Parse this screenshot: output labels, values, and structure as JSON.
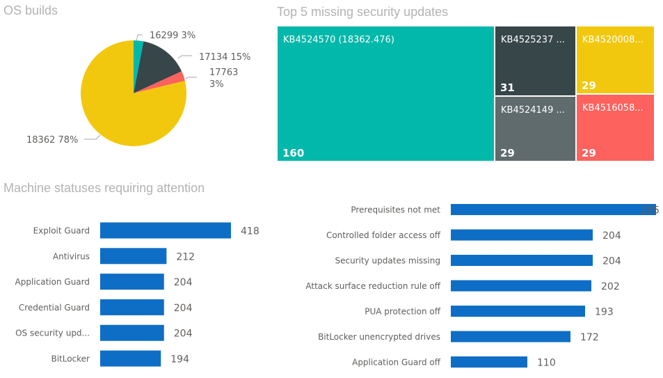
{
  "colors": {
    "teal": "#01b8aa",
    "dark": "#374649",
    "red": "#fd625e",
    "yellow": "#f2c80f",
    "gray": "#5f6b6d",
    "bar": "#0e6ec5",
    "label": "#605e5c",
    "title": "#b3b3b3",
    "leader": "#a6a6a6"
  },
  "chart_data": [
    {
      "id": "os-builds",
      "type": "pie",
      "title": "OS builds",
      "slices": [
        {
          "label": "16299",
          "percent": 3,
          "display": "16299 3%",
          "color_key": "teal"
        },
        {
          "label": "17134",
          "percent": 15,
          "display": "17134 15%",
          "color_key": "dark"
        },
        {
          "label": "17763",
          "percent": 3,
          "display_lines": [
            "17763",
            "3%"
          ],
          "color_key": "red"
        },
        {
          "label": "18362",
          "percent": 78,
          "display": "18362 78%",
          "color_key": "yellow"
        }
      ]
    },
    {
      "id": "top-missing-updates",
      "type": "treemap",
      "title": "Top 5 missing security updates",
      "items": [
        {
          "label": "KB4524570 (18362.476)",
          "value": 160,
          "color_key": "teal"
        },
        {
          "label": "KB4525237 ...",
          "value": 31,
          "color_key": "dark"
        },
        {
          "label": "KB4524149 ...",
          "value": 29,
          "color_key": "gray"
        },
        {
          "label": "KB4520008...",
          "value": 29,
          "color_key": "yellow"
        },
        {
          "label": "KB4516058...",
          "value": 29,
          "color_key": "red"
        }
      ]
    },
    {
      "id": "machine-statuses",
      "type": "bar",
      "orientation": "horizontal",
      "title": "Machine statuses requiring attention",
      "categories": [
        "Exploit Guard",
        "Antivirus",
        "Application Guard",
        "Credential Guard",
        "OS security upd...",
        "BitLocker"
      ],
      "values": [
        418,
        212,
        204,
        204,
        204,
        194
      ],
      "xlim": [
        0,
        418
      ]
    },
    {
      "id": "security-issues",
      "type": "bar",
      "orientation": "horizontal",
      "title": "",
      "categories": [
        "Prerequisites not met",
        "Controlled folder access off",
        "Security updates missing",
        "Attack surface reduction rule off",
        "PUA protection off",
        "BitLocker unencrypted drives",
        "Application Guard off"
      ],
      "values": [
        295,
        204,
        204,
        202,
        193,
        172,
        110
      ],
      "xlim": [
        0,
        295
      ]
    }
  ]
}
